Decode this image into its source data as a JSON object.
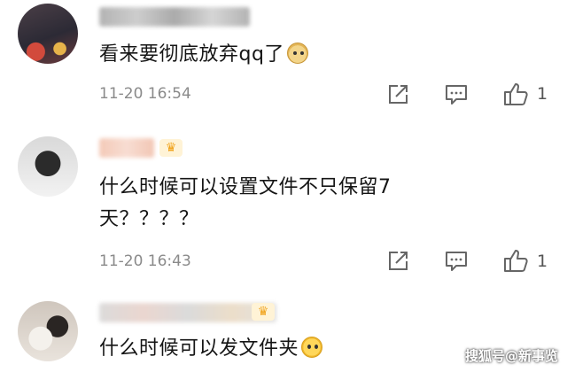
{
  "comments": [
    {
      "text": "看来要彻底放弃qq了",
      "emoji": "doge-emoji",
      "time": "11-20 16:54",
      "likes": "1"
    },
    {
      "text_line1": "什么时候可以设置文件不只保留7",
      "text_line2": "天？？？？",
      "time": "11-20 16:43",
      "likes": "1"
    },
    {
      "text": "什么时候可以发文件夹",
      "emoji": "thinking-emoji"
    }
  ],
  "watermark": "搜狐号@新事览",
  "colors": {
    "meta_text": "#8a8a8a",
    "icon_stroke": "#666666"
  }
}
